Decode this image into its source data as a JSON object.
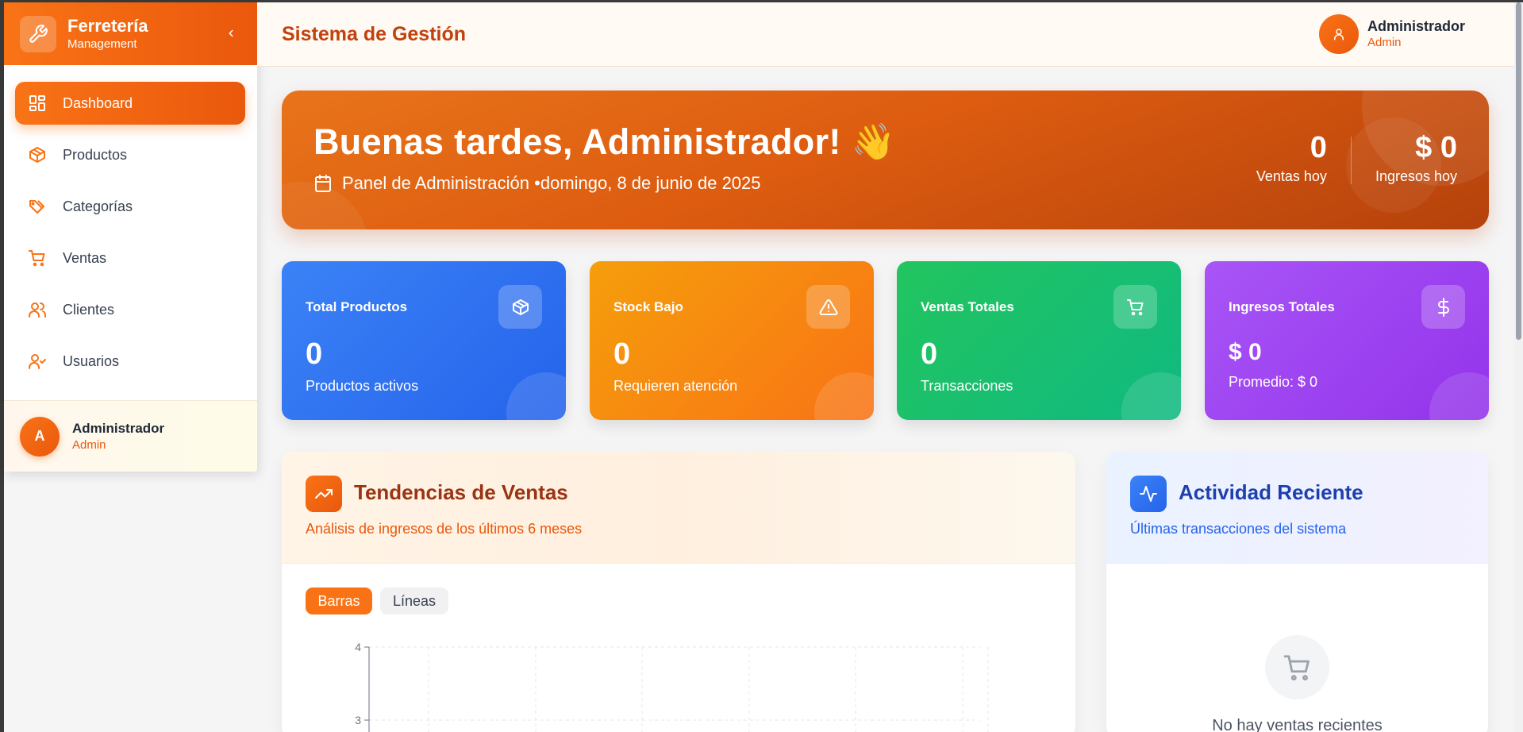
{
  "brand": {
    "name": "Ferretería",
    "subtitle": "Management"
  },
  "sidebar": {
    "items": [
      {
        "label": "Dashboard",
        "icon": "dashboard-icon",
        "active": true
      },
      {
        "label": "Productos",
        "icon": "box-icon"
      },
      {
        "label": "Categorías",
        "icon": "tag-icon"
      },
      {
        "label": "Ventas",
        "icon": "cart-icon"
      },
      {
        "label": "Clientes",
        "icon": "users-icon"
      },
      {
        "label": "Usuarios",
        "icon": "user-check-icon"
      }
    ],
    "user": {
      "initial": "A",
      "name": "Administrador",
      "role": "Admin"
    }
  },
  "header": {
    "title": "Sistema de Gestión",
    "user": {
      "name": "Administrador",
      "role": "Admin"
    }
  },
  "hero": {
    "greeting": "Buenas tardes, Administrador! 👋",
    "subtitle": "Panel de Administración •domingo, 8 de junio de 2025",
    "stats": [
      {
        "value": "0",
        "label": "Ventas hoy"
      },
      {
        "value": "$ 0",
        "label": "Ingresos hoy"
      }
    ]
  },
  "cards": [
    {
      "title": "Total Productos",
      "value": "0",
      "desc": "Productos activos",
      "icon": "box-icon",
      "color": "#3b82f6"
    },
    {
      "title": "Stock Bajo",
      "value": "0",
      "desc": "Requieren atención",
      "icon": "warning-icon",
      "color": "#f59e0b"
    },
    {
      "title": "Ventas Totales",
      "value": "0",
      "desc": "Transacciones",
      "icon": "cart-icon",
      "color": "#22c55e"
    },
    {
      "title": "Ingresos Totales",
      "value": "$ 0",
      "desc": "Promedio: $ 0",
      "icon": "dollar-icon",
      "color": "#a855f7"
    }
  ],
  "trends": {
    "title": "Tendencias de Ventas",
    "subtitle": "Análisis de ingresos de los últimos 6 meses",
    "toggle": {
      "bars": "Barras",
      "lines": "Líneas",
      "active": "bars"
    }
  },
  "chart_data": {
    "type": "bar",
    "y_ticks_visible": [
      "4",
      "3"
    ],
    "ylim": [
      0,
      4
    ],
    "grid": true
  },
  "activity": {
    "title": "Actividad Reciente",
    "subtitle": "Últimas transacciones del sistema",
    "empty": "No hay ventas recientes"
  },
  "colors": {
    "accent": "#f97316",
    "accent_dark": "#ea580c",
    "header_title": "#c2410c"
  }
}
